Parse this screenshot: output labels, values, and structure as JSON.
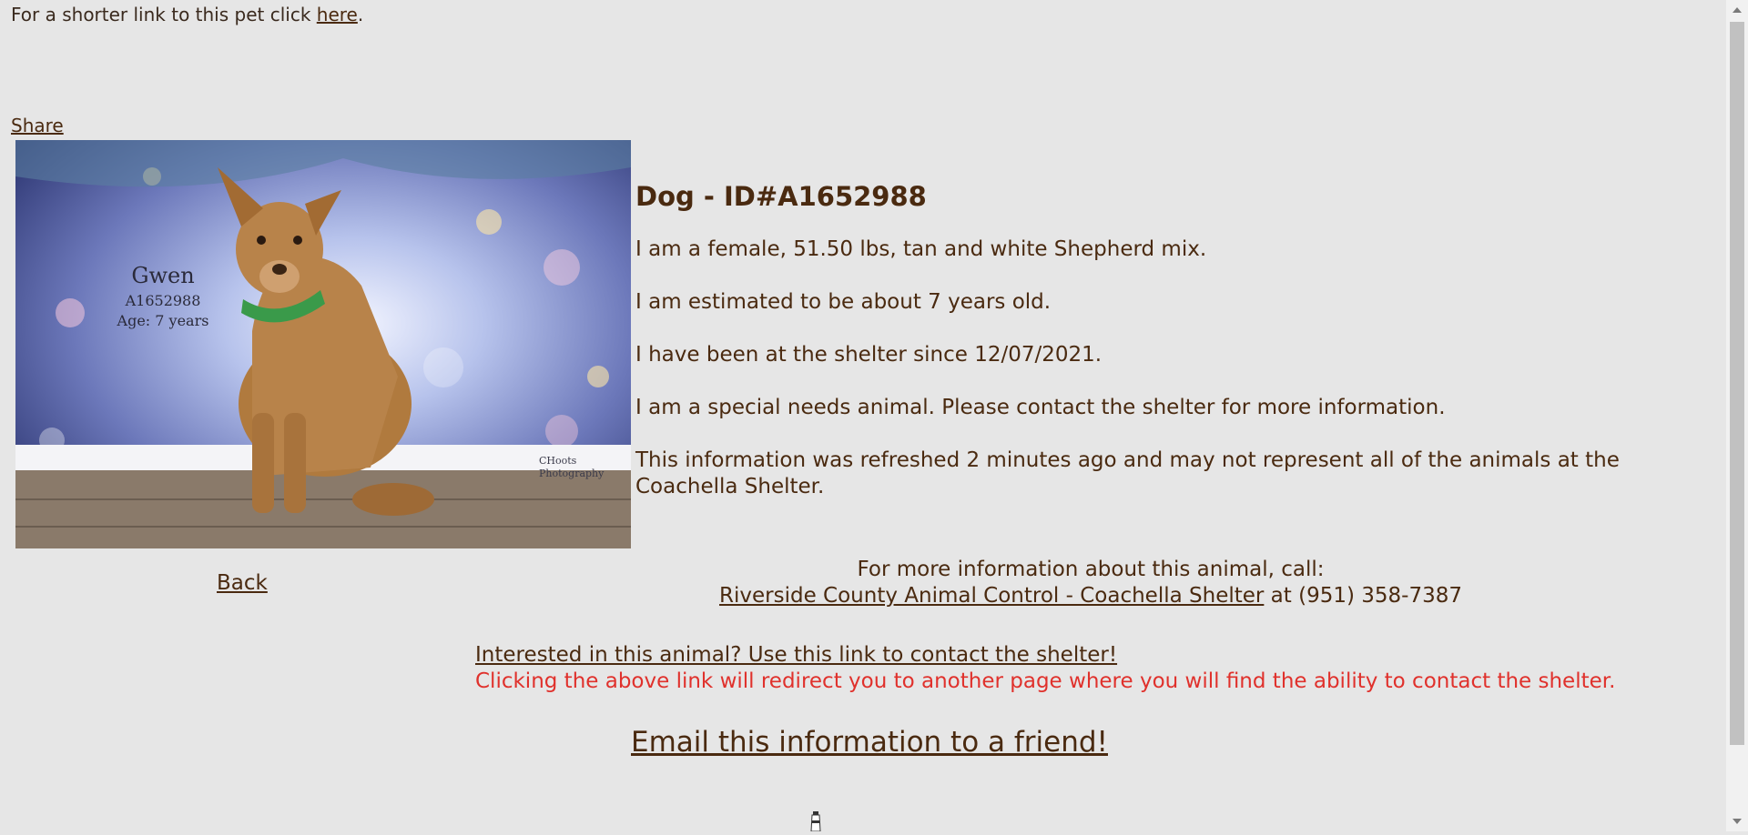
{
  "top_note": {
    "text": "For a shorter link to this pet click ",
    "link": "here",
    "end": "."
  },
  "share_label": "Share",
  "photo": {
    "alt": "Photo of Gwen, a tan and white Shepherd mix dog",
    "caption_name": "Gwen",
    "caption_id": "A1652988",
    "caption_age": "Age: 7 years",
    "watermark_line1": "CHoots",
    "watermark_line2": "Photography"
  },
  "animal": {
    "heading": "Dog - ID#A1652988",
    "desc": "I am a female, 51.50 lbs, tan and white Shepherd mix.",
    "age": "I am estimated to be about 7 years old.",
    "since": "I have been at the shelter since 12/07/2021.",
    "special": "I am a special needs animal. Please contact the shelter for more information.",
    "refresh": "This information was refreshed 2 minutes ago and may not represent all of the animals at the Coachella Shelter."
  },
  "back_label": "Back",
  "contact": {
    "line1": "For more information about this animal, call:",
    "shelter_link": "Riverside County Animal Control - Coachella Shelter",
    "phone_text": " at (951) 358-7387"
  },
  "interest": {
    "link": "Interested in this animal? Use this link to contact the shelter!",
    "note": "Clicking the above link will redirect you to another page where you will find the ability to contact the shelter."
  },
  "email_label": "Email this information to a friend!",
  "icons": {
    "photo": "dog-photo",
    "badge": "lighthouse-icon",
    "scroll_up": "scroll-up-arrow-icon",
    "scroll_down": "scroll-down-arrow-icon"
  },
  "colors": {
    "background": "#e6e6e6",
    "text": "#4a2a10",
    "warning": "#e0312c"
  }
}
